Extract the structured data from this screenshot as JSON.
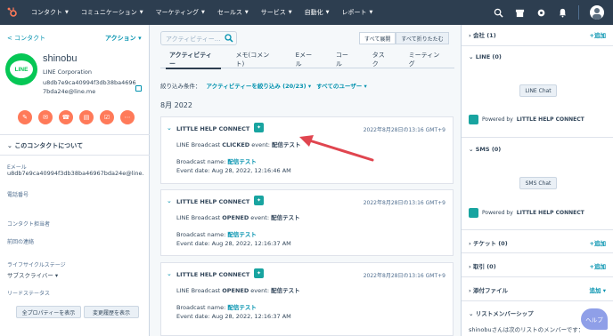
{
  "nav": {
    "items": [
      "コンタクト",
      "コミュニケーション",
      "マーケティング",
      "セールス",
      "サービス",
      "自動化",
      "レポート"
    ]
  },
  "left": {
    "back_label": "< コンタクト",
    "actions_label": "アクション ▾",
    "avatar_text": "LINE",
    "name": "shinobu",
    "company": "LINE Corporation",
    "uid_email": "u8db7e9ca40994f3db38ba46967bda24e@line.me",
    "about_heading": "このコンタクトについて",
    "fields": [
      {
        "label": "Eメール",
        "value": "u8db7e9ca40994f3db38ba46967bda24e@line..."
      },
      {
        "label": "電話番号",
        "value": ""
      },
      {
        "label": "コンタクト担当者",
        "value": ""
      },
      {
        "label": "前回の連絡",
        "value": ""
      },
      {
        "label": "ライフサイクルステージ",
        "value": "サブスクライバー ▾"
      },
      {
        "label": "リードステータス",
        "value": ""
      }
    ],
    "btn_all_props": "全プロパティーを表示",
    "btn_history": "変更履歴を表示"
  },
  "main": {
    "search_placeholder": "アクティビティー...",
    "expand_all": "すべて展開",
    "collapse_all": "すべて折りたたむ",
    "tabs": [
      "アクティビティー",
      "メモ(コメント)",
      "Eメール",
      "コール",
      "タスク",
      "ミーティング"
    ],
    "filter_label": "絞り込み条件：",
    "filter_activity": "アクティビティーを絞り込み (20/23) ▾",
    "filter_users": "すべてのユーザー ▾",
    "month": "8月 2022",
    "cards": [
      {
        "title": "LITTLE HELP CONNECT",
        "date": "2022年8月28日の13:16 GMT+9",
        "event_prefix": "LINE Broadcast ",
        "event_type": "CLICKED",
        "event_suffix": " event: ",
        "event_name": "配信テスト",
        "broadcast_label": "Broadcast name: ",
        "broadcast_name": "配信テスト",
        "event_date": "Event date: Aug 28, 2022, 12:16:46 AM"
      },
      {
        "title": "LITTLE HELP CONNECT",
        "date": "2022年8月28日の13:16 GMT+9",
        "event_prefix": "LINE Broadcast ",
        "event_type": "OPENED",
        "event_suffix": " event: ",
        "event_name": "配信テスト",
        "broadcast_label": "Broadcast name: ",
        "broadcast_name": "配信テスト",
        "event_date": "Event date: Aug 28, 2022, 12:16:37 AM"
      },
      {
        "title": "LITTLE HELP CONNECT",
        "date": "2022年8月28日の13:16 GMT+9",
        "event_prefix": "LINE Broadcast ",
        "event_type": "OPENED",
        "event_suffix": " event: ",
        "event_name": "配信テスト",
        "broadcast_label": "Broadcast name: ",
        "broadcast_name": "配信テスト",
        "event_date": "Event date: Aug 28, 2022, 12:16:37 AM"
      }
    ]
  },
  "right": {
    "company_head": "会社 (1)",
    "company_add": "+追加",
    "line_head": "LINE (0)",
    "line_btn": "LINE Chat",
    "powered_by": "Powered by",
    "powered_name": "LITTLE HELP CONNECT",
    "sms_head": "SMS (0)",
    "sms_btn": "SMS Chat",
    "ticket_head": "チケット (0)",
    "ticket_add": "+追加",
    "deal_head": "取引 (0)",
    "deal_add": "+追加",
    "attach_head": "添付ファイル",
    "attach_add": "追加 ▾",
    "list_head": "リストメンバーシップ",
    "list_text": "shinobuさんは次のリストのメンバーです：",
    "help_label": "ヘルプ"
  },
  "colors": {
    "nav_bg": "#2d3e50",
    "accent": "#0091ae",
    "action_orange": "#ff7a59",
    "line_green": "#06c755",
    "arrow_red": "#e0454f"
  }
}
